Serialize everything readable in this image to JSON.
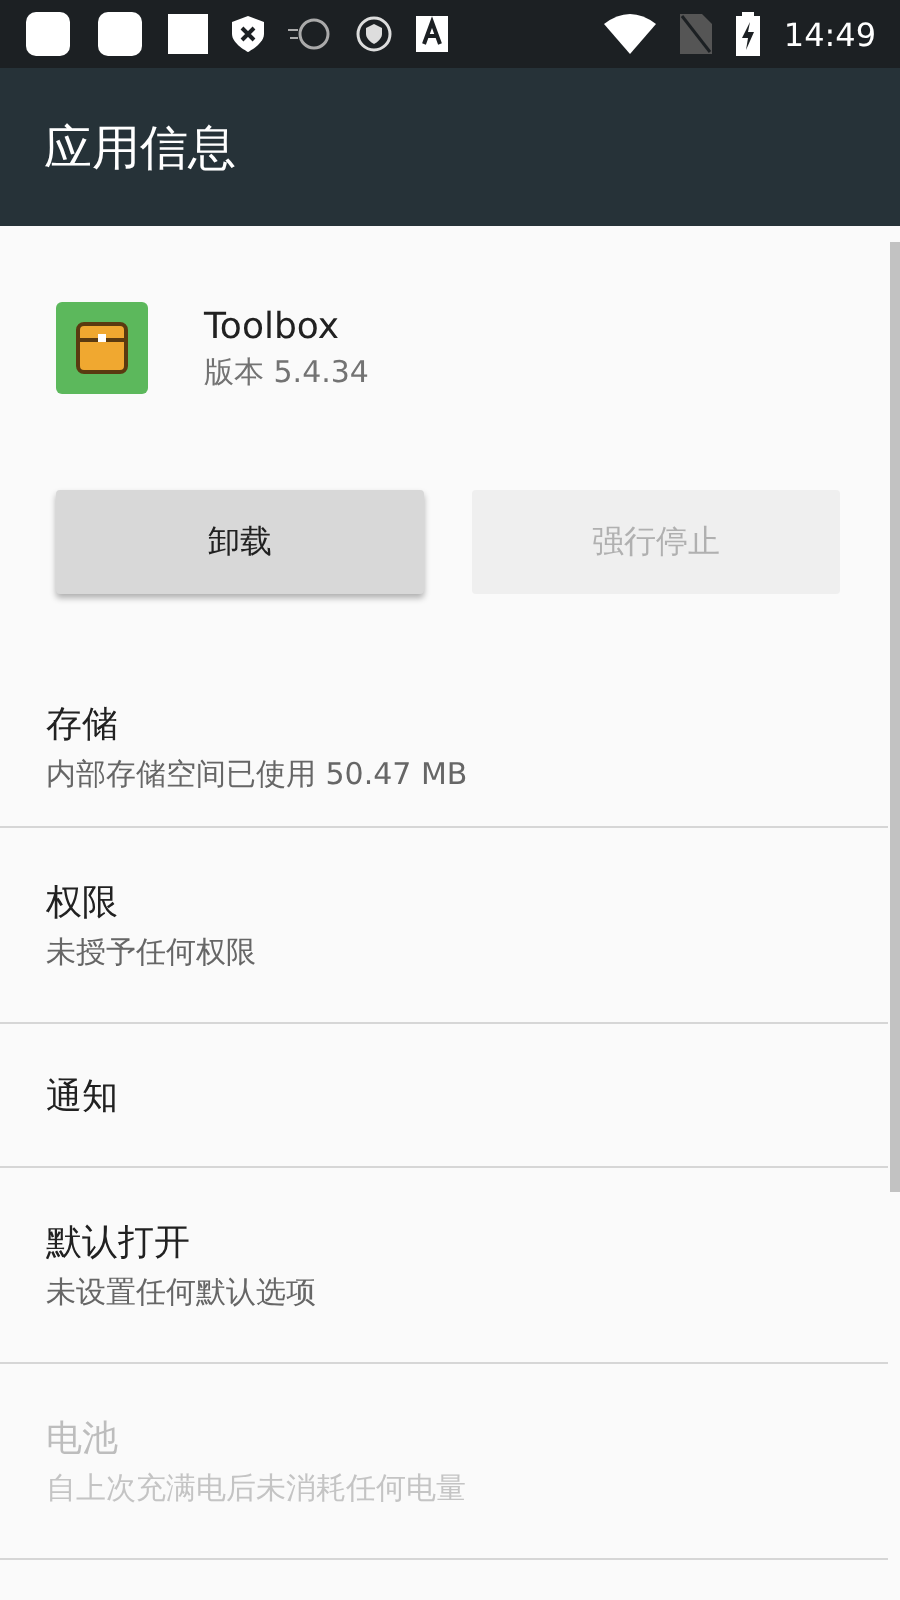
{
  "status_bar": {
    "time": "14:49"
  },
  "app_bar": {
    "title": "应用信息"
  },
  "app": {
    "name": "Toolbox",
    "version": "版本 5.4.34"
  },
  "buttons": [
    {
      "label": "卸载",
      "disabled": false
    },
    {
      "label": "强行停止",
      "disabled": true
    }
  ],
  "settings": [
    {
      "title": "存储",
      "summary": "内部存储空间已使用 50.47 MB",
      "disabled": false
    },
    {
      "title": "权限",
      "summary": "未授予任何权限",
      "disabled": false
    },
    {
      "title": "通知",
      "disabled": false
    },
    {
      "title": "默认打开",
      "summary": "未设置任何默认选项",
      "disabled": false
    },
    {
      "title": "电池",
      "summary": "自上次充满电后未消耗任何电量",
      "disabled": true
    }
  ]
}
